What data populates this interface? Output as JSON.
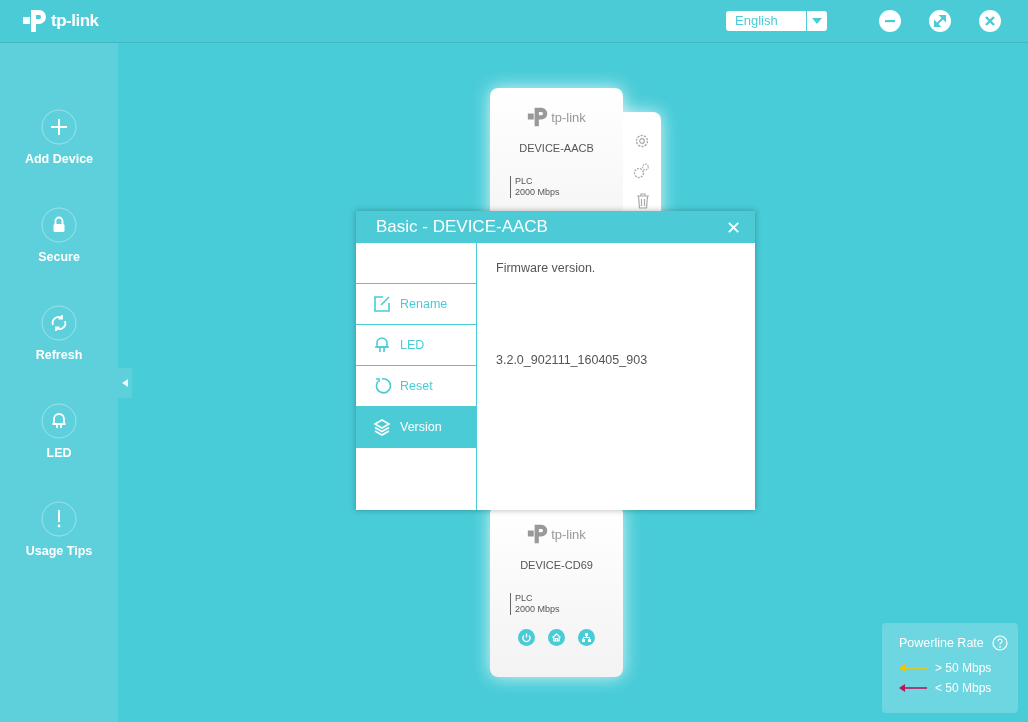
{
  "header": {
    "logo": "tp-link",
    "language": "English"
  },
  "sidebar": {
    "items": [
      {
        "label": "Add Device",
        "kind": "add"
      },
      {
        "label": "Secure",
        "kind": "lock"
      },
      {
        "label": "Refresh",
        "kind": "refresh"
      },
      {
        "label": "LED",
        "kind": "led"
      },
      {
        "label": "Usage Tips",
        "kind": "tips"
      }
    ]
  },
  "devices": [
    {
      "kind": "actions",
      "logo": "tp-link",
      "name": "DEVICE-AACB",
      "type": "PLC",
      "rate": "2000 Mbps"
    },
    {
      "kind": "status",
      "logo": "tp-link",
      "name": "DEVICE-CD69",
      "type": "PLC",
      "rate": "2000 Mbps"
    }
  ],
  "dialog": {
    "title": "Basic - DEVICE-AACB",
    "close": "✕",
    "menu": [
      {
        "label": "Rename",
        "kind": "rename",
        "selected": false
      },
      {
        "label": "LED",
        "kind": "led",
        "selected": false
      },
      {
        "label": "Reset",
        "kind": "reset",
        "selected": false
      },
      {
        "label": "Version",
        "kind": "version",
        "selected": true
      }
    ],
    "heading": "Firmware version.",
    "value": "3.2.0_902111_160405_903"
  },
  "legend": {
    "title": "Powerline Rate",
    "items": [
      {
        "label": "> 50 Mbps",
        "color": "#f2c500"
      },
      {
        "label": "< 50 Mbps",
        "color": "#b8175a"
      }
    ]
  }
}
